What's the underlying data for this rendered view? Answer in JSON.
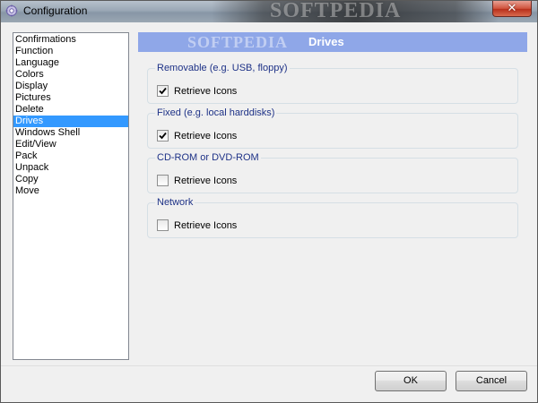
{
  "window": {
    "title": "Configuration",
    "watermark": "SOFTPEDIA",
    "close_glyph": "✕"
  },
  "nav": {
    "items": [
      {
        "label": "Confirmations",
        "selected": false
      },
      {
        "label": "Function",
        "selected": false
      },
      {
        "label": "Language",
        "selected": false
      },
      {
        "label": "Colors",
        "selected": false
      },
      {
        "label": "Display",
        "selected": false
      },
      {
        "label": "Pictures",
        "selected": false
      },
      {
        "label": "Delete",
        "selected": false
      },
      {
        "label": "Drives",
        "selected": true
      },
      {
        "label": "Windows Shell",
        "selected": false
      },
      {
        "label": "Edit/View",
        "selected": false
      },
      {
        "label": "Pack",
        "selected": false
      },
      {
        "label": "Unpack",
        "selected": false
      },
      {
        "label": "Copy",
        "selected": false
      },
      {
        "label": "Move",
        "selected": false
      }
    ]
  },
  "panel": {
    "watermark": "SOFTPEDIA",
    "title": "Drives",
    "groups": [
      {
        "legend": "Removable (e.g. USB, floppy)",
        "option_label": "Retrieve Icons",
        "checked": true
      },
      {
        "legend": "Fixed (e.g. local harddisks)",
        "option_label": "Retrieve Icons",
        "checked": true
      },
      {
        "legend": "CD-ROM or DVD-ROM",
        "option_label": "Retrieve Icons",
        "checked": false
      },
      {
        "legend": "Network",
        "option_label": "Retrieve Icons",
        "checked": false
      }
    ]
  },
  "buttons": {
    "ok_label": "OK",
    "cancel_label": "Cancel"
  },
  "colors": {
    "selection": "#3399ff",
    "header_bar": "#8fa7e8",
    "group_legend": "#1e3287"
  }
}
